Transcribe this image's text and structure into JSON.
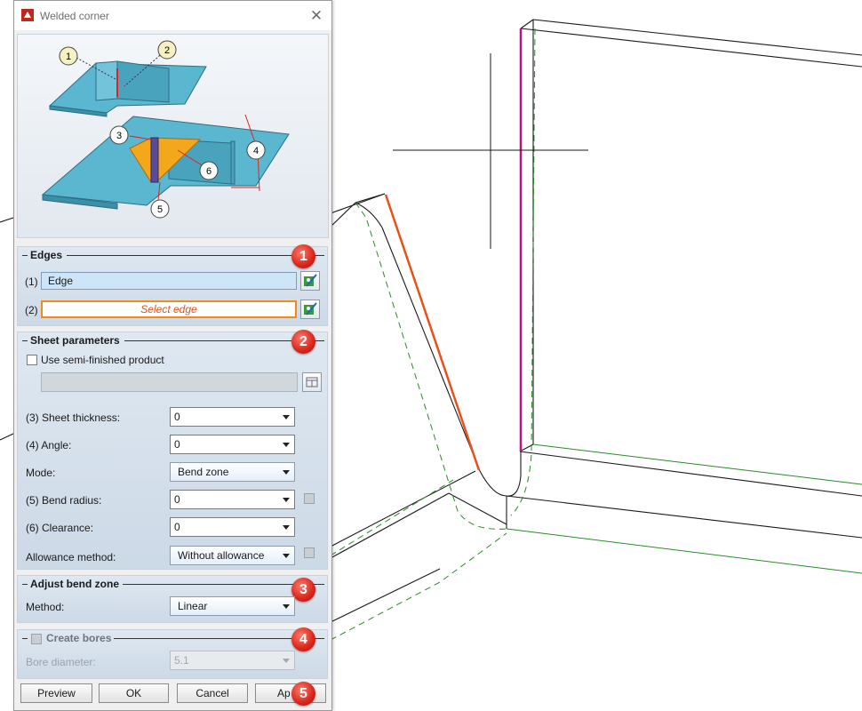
{
  "window": {
    "title": "Welded corner"
  },
  "colors": {
    "accent_red": "#d8251a",
    "edge_orange": "#f08a1c",
    "group_bg": "#d3dfeb"
  },
  "preview": {
    "callouts": [
      "1",
      "2",
      "3",
      "4",
      "5",
      "6"
    ]
  },
  "edges": {
    "title": "Edges",
    "badge": "1",
    "edge1_label": "(1)",
    "edge1_value": "Edge",
    "edge2_label": "(2)",
    "edge2_value": "Select edge"
  },
  "sheet": {
    "title": "Sheet parameters",
    "badge": "2",
    "semi_finished_label": "Use semi-finished product",
    "semi_finished_checked": false,
    "thickness_label": "(3) Sheet thickness:",
    "thickness_value": "0",
    "angle_label": "(4) Angle:",
    "angle_value": "0",
    "mode_label": "Mode:",
    "mode_value": "Bend zone",
    "bend_radius_label": "(5) Bend radius:",
    "bend_radius_value": "0",
    "clearance_label": "(6) Clearance:",
    "clearance_value": "0",
    "allowance_label": "Allowance method:",
    "allowance_value": "Without allowance"
  },
  "adjust": {
    "title": "Adjust bend zone",
    "badge": "3",
    "method_label": "Method:",
    "method_value": "Linear"
  },
  "bores": {
    "title": "Create bores",
    "badge": "4",
    "checked": false,
    "diameter_label": "Bore diameter:",
    "diameter_value": "5.1"
  },
  "buttons": {
    "preview": "Preview",
    "ok": "OK",
    "cancel": "Cancel",
    "apply": "Ap",
    "badge": "5"
  }
}
